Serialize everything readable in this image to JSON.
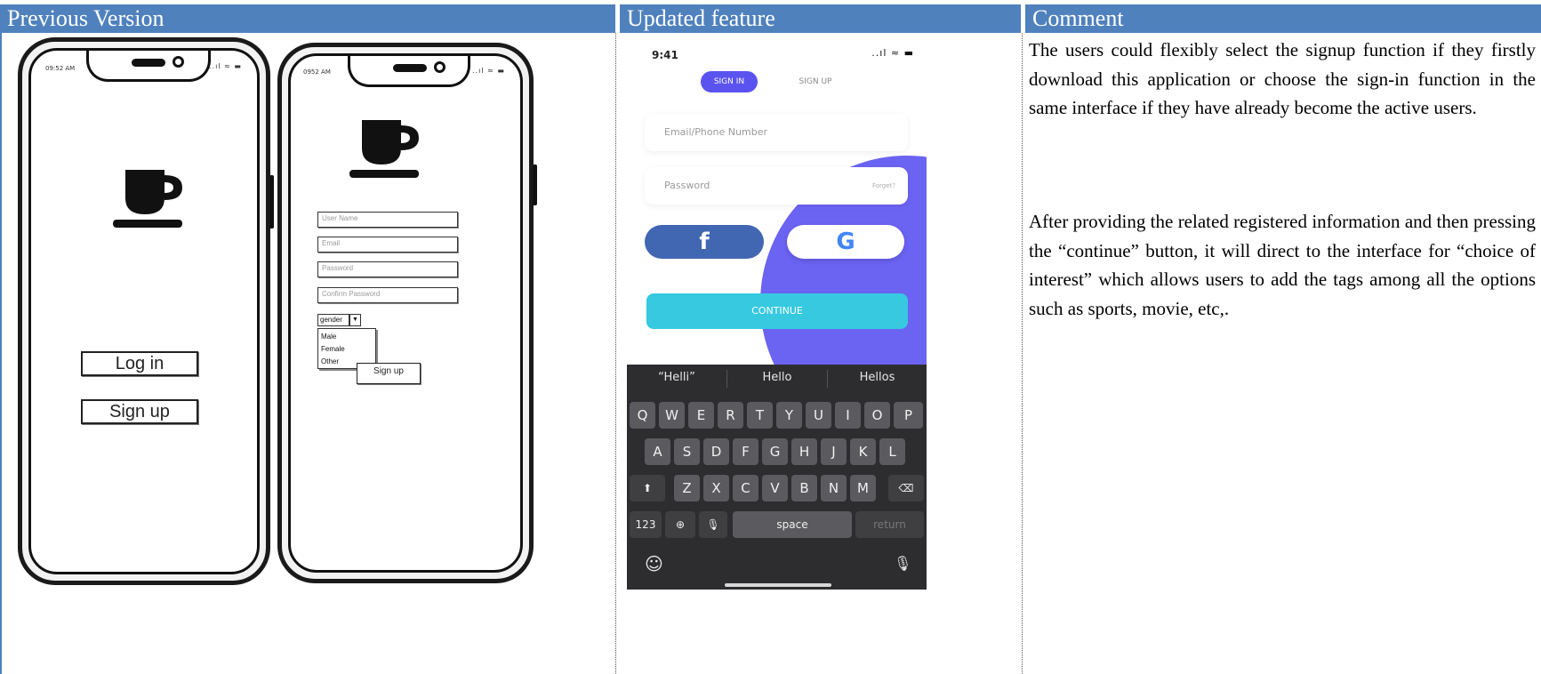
{
  "headers": {
    "previous": "Previous Version",
    "updated": "Updated feature",
    "comment": "Comment"
  },
  "wireframe": {
    "phone1": {
      "time": "09:52 AM",
      "status_icons": "..ıl ≈ ▬",
      "login_label": "Log in",
      "signup_label": "Sign up"
    },
    "phone2": {
      "time": "0952 AM",
      "status_icons": "..ıl ≈ ▬",
      "fields": [
        "User Name",
        "Email",
        "Password",
        "Confirm Password"
      ],
      "gender_label": "gender",
      "gender_options": [
        "Male",
        "Female",
        "Other"
      ],
      "signup_label": "Sign up"
    }
  },
  "mobile": {
    "time": "9:41",
    "status_icons": "..ıl ≈ ▬",
    "tab_signin": "SIGN IN",
    "tab_signup": "SIGN UP",
    "email_placeholder": "Email/Phone Number",
    "password_placeholder": "Password",
    "forgot_label": "Forget?",
    "facebook_glyph": "f",
    "google_glyph": "G",
    "continue_label": "CONTINUE",
    "keyboard": {
      "suggestions": [
        "“Helli”",
        "Hello",
        "Hellos"
      ],
      "row1": [
        "Q",
        "W",
        "E",
        "R",
        "T",
        "Y",
        "U",
        "I",
        "O",
        "P"
      ],
      "row2": [
        "A",
        "S",
        "D",
        "F",
        "G",
        "H",
        "J",
        "K",
        "L"
      ],
      "row3": [
        "Z",
        "X",
        "C",
        "V",
        "B",
        "N",
        "M"
      ],
      "numbers_key": "123",
      "space_key": "space",
      "return_key": "return",
      "globe_glyph": "⊕",
      "mic_glyph": "🎙",
      "emoji_glyph": "☺",
      "shift_glyph": "⬆",
      "delete_glyph": "⌫"
    }
  },
  "comment": {
    "paragraph1": "The users could flexibly select the signup function if they firstly download this application or choose the sign-in function in the same interface if they have already become the active users.",
    "paragraph2": "After providing the related registered information and then pressing the “continue” button, it will direct to the interface for “choice of interest” which allows users to add the tags among all the options such as sports, movie, etc,."
  },
  "colors": {
    "header_bg": "#4f81bd",
    "header_text": "#ffffff",
    "signin_tab": "#5a53f0",
    "blob": "#6b63f2",
    "facebook": "#4267b2",
    "continue": "#36c9e0",
    "keyboard_bg": "#2d2d30"
  }
}
